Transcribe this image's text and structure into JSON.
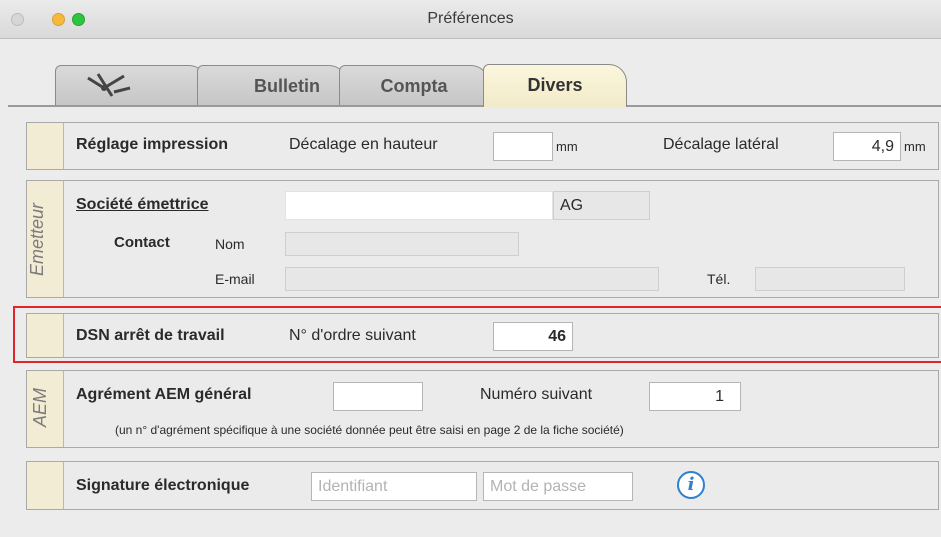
{
  "window": {
    "title": "Préférences"
  },
  "tabs": [
    {
      "label": "",
      "icon": "tools-icon"
    },
    {
      "label": "Bulletin"
    },
    {
      "label": "Compta"
    },
    {
      "label": "Divers",
      "active": true
    }
  ],
  "print": {
    "label": "Réglage impression",
    "vertical_label": "Décalage en hauteur",
    "vertical_value": "",
    "vertical_unit": "mm",
    "lateral_label": "Décalage latéral",
    "lateral_value": "4,9",
    "lateral_unit": "mm"
  },
  "emitter": {
    "strip_label": "Emetteur",
    "company_label": "Société émettrice",
    "company_value": "",
    "company_code": "AG",
    "contact_label": "Contact",
    "name_label": "Nom",
    "name_value": "",
    "email_label": "E-mail",
    "email_value": "",
    "phone_label": "Tél.",
    "phone_value": ""
  },
  "dsn": {
    "label": "DSN arrêt de travail",
    "order_label": "N° d'ordre suivant",
    "order_value": "46"
  },
  "aem": {
    "strip_label": "AEM",
    "label": "Agrément AEM général",
    "approval_value": "",
    "next_label": "Numéro suivant",
    "next_value": "1",
    "note": "(un n° d'agrément spécifique à une société donnée peut être saisi en page 2 de la fiche société)"
  },
  "signature": {
    "label": "Signature électronique",
    "id_placeholder": "Identifiant",
    "password_placeholder": "Mot de passe",
    "info_glyph": "i"
  }
}
